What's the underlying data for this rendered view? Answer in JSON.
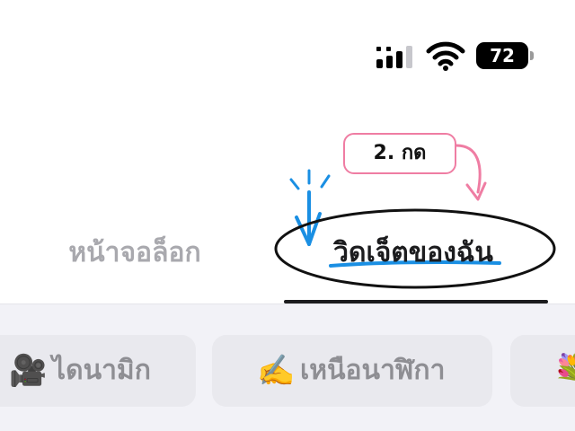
{
  "status_bar": {
    "battery": "72",
    "signal_icon": "cellular-signal-icon",
    "wifi_icon": "wifi-icon"
  },
  "annotation": {
    "step_label": "2. กด",
    "color": "#ef7da3",
    "highlight_color": "#1a8fe3"
  },
  "tabs": [
    {
      "label": "หน้าจอล็อก",
      "selected": false
    },
    {
      "label": "วิดเจ็ตของฉัน",
      "selected": true
    }
  ],
  "chips": [
    {
      "emoji": "🎥",
      "label": "ไดนามิก"
    },
    {
      "emoji": "✍️",
      "label": "เหนือนาฬิกา"
    },
    {
      "emoji": "💐",
      "label": ""
    }
  ]
}
